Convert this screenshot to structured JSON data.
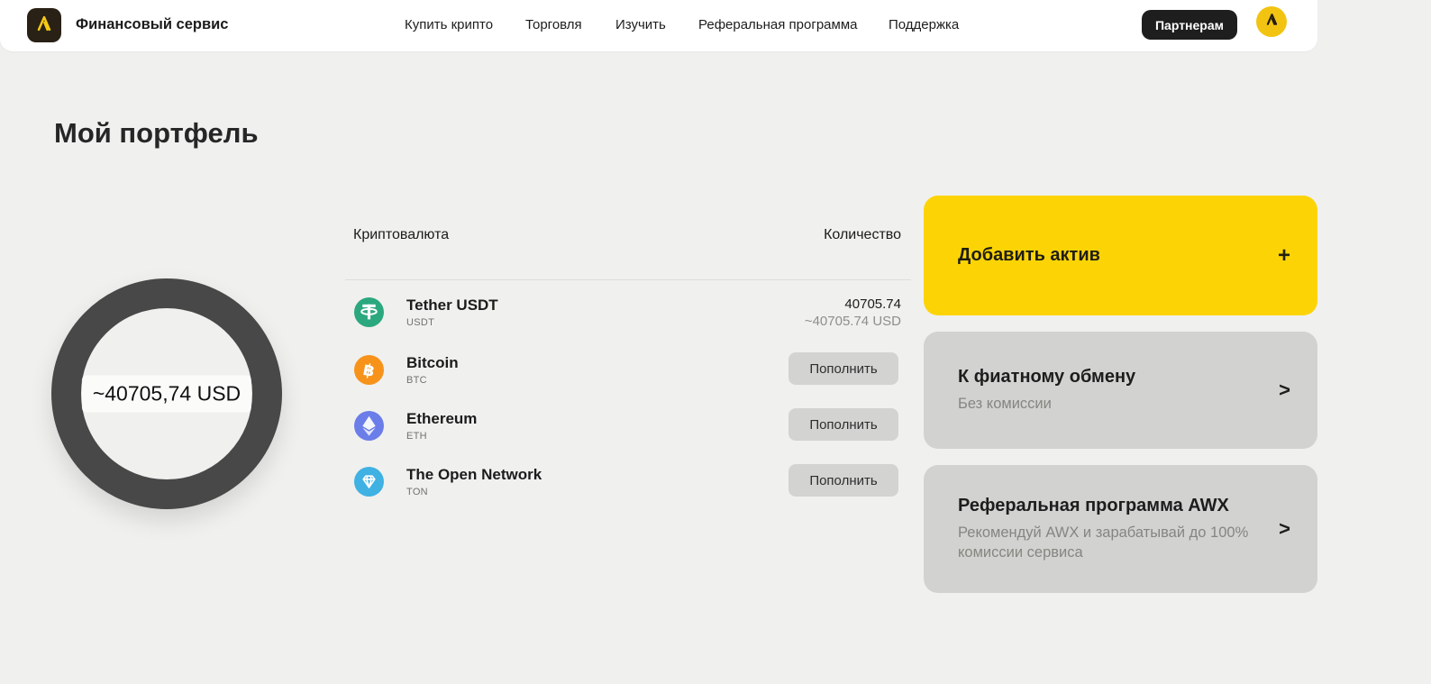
{
  "header": {
    "brand": "Финансовый сервис",
    "nav": [
      {
        "label": "Купить крипто"
      },
      {
        "label": "Торговля"
      },
      {
        "label": "Изучить"
      },
      {
        "label": "Реферальная программа"
      },
      {
        "label": "Поддержка"
      }
    ],
    "partners_button": "Партнерам"
  },
  "page": {
    "title": "Мой портфель"
  },
  "portfolio": {
    "total_label": "~40705,74 USD"
  },
  "table": {
    "columns": {
      "currency": "Криптовалюта",
      "amount": "Количество"
    },
    "rows": [
      {
        "name": "Tether USDT",
        "ticker": "USDT",
        "amount": "40705.74",
        "amount_usd": "~40705.74 USD"
      },
      {
        "name": "Bitcoin",
        "ticker": "BTC",
        "action": "Пополнить"
      },
      {
        "name": "Ethereum",
        "ticker": "ETH",
        "action": "Пополнить"
      },
      {
        "name": "The Open Network",
        "ticker": "TON",
        "action": "Пополнить"
      }
    ]
  },
  "cards": {
    "add_asset": {
      "title": "Добавить актив",
      "icon": "+"
    },
    "fiat_exchange": {
      "title": "К фиатному обмену",
      "subtitle": "Без комиссии",
      "icon": ">"
    },
    "referral": {
      "title": "Реферальная программа AWX",
      "subtitle": "Рекомендуй AWX и зарабатывай до 100% комиссии сервиса",
      "icon": ">"
    }
  },
  "icons": {
    "brand_logo": "awx-logo-icon",
    "avatar": "awx-avatar-icon",
    "assets": [
      "tether-icon",
      "bitcoin-icon",
      "ethereum-icon",
      "ton-icon"
    ],
    "add": "plus-icon",
    "chevron": "chevron-right-icon"
  },
  "colors": {
    "accent_yellow": "#fcd406",
    "header_dark": "#1e1e1e",
    "donut_ring": "#484848",
    "card_gray": "#d2d2d0",
    "tether_green": "#2ba87e",
    "bitcoin_orange": "#f7931a",
    "ethereum_blue": "#6b7de8",
    "ton_blue": "#3fb1e3"
  }
}
